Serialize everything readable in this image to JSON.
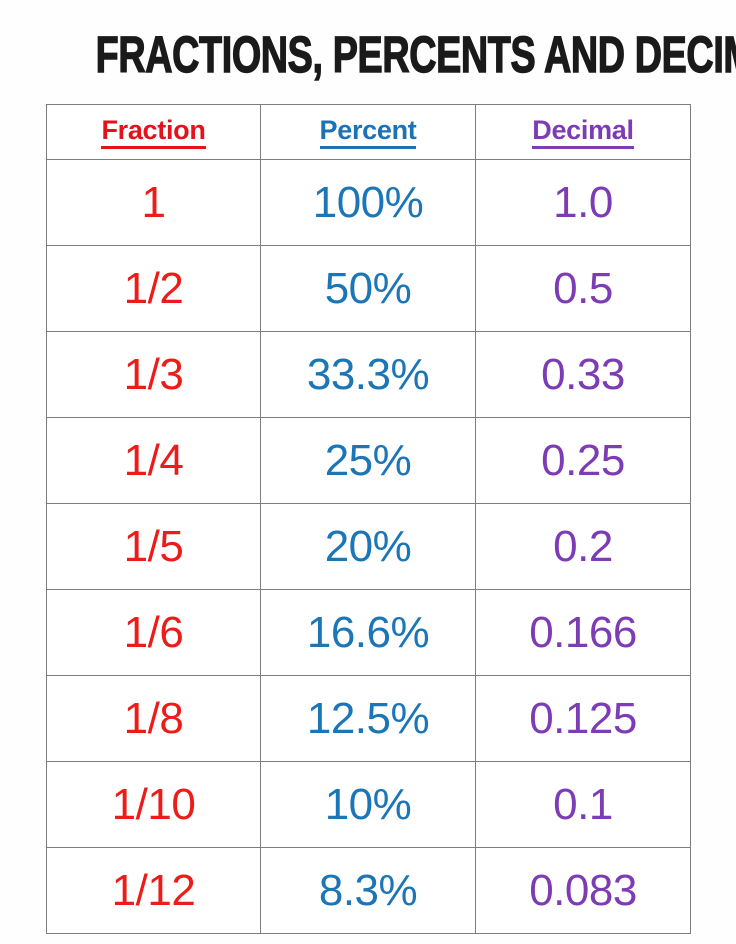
{
  "document": {
    "title": "FRACTIONS, PERCENTS AND DECIMALS"
  },
  "table": {
    "headers": [
      {
        "label": "Fraction",
        "color": "#e5111b"
      },
      {
        "label": "Percent",
        "color": "#1b72b5"
      },
      {
        "label": "Decimal",
        "color": "#7d3cb5"
      }
    ],
    "rows": [
      {
        "fraction": "1",
        "percent": "100%",
        "decimal": "1.0"
      },
      {
        "fraction": "1/2",
        "percent": "50%",
        "decimal": "0.5"
      },
      {
        "fraction": "1/3",
        "percent": "33.3%",
        "decimal": "0.33"
      },
      {
        "fraction": "1/4",
        "percent": "25%",
        "decimal": "0.25"
      },
      {
        "fraction": "1/5",
        "percent": "20%",
        "decimal": "0.2"
      },
      {
        "fraction": "1/6",
        "percent": "16.6%",
        "decimal": "0.166"
      },
      {
        "fraction": "1/8",
        "percent": "12.5%",
        "decimal": "0.125"
      },
      {
        "fraction": "1/10",
        "percent": "10%",
        "decimal": "0.1"
      },
      {
        "fraction": "1/12",
        "percent": "8.3%",
        "decimal": "0.083"
      }
    ]
  },
  "colors": {
    "fraction": "#ee1c18",
    "percent": "#1b76b8",
    "decimal": "#7d3cb5",
    "title": "#1a1a1a",
    "border": "#7d7d7d",
    "background": "#fefefe"
  }
}
